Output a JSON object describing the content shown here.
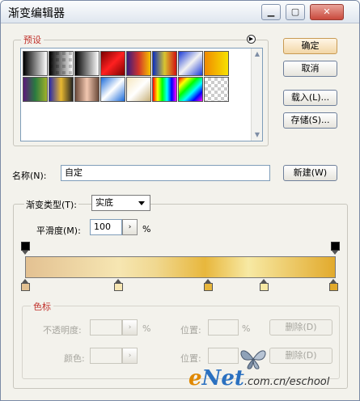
{
  "window": {
    "title": "渐变编辑器",
    "minimize_glyph": "▁",
    "maximize_glyph": "▢",
    "close_glyph": "✕"
  },
  "presets": {
    "label": "预设",
    "menu_icon": "circle-arrow-icon",
    "swatches": [
      "linear-gradient(to right,#000,#fff)",
      "checker-black",
      "linear-gradient(to right,#000,#fff)",
      "linear-gradient(135deg,#7a0000,#ff2020,#7a0000)",
      "linear-gradient(to right,#3a1c80,#d2342a,#f5c400)",
      "linear-gradient(to right,#0a2dbf,#d8c630,#d11111)",
      "linear-gradient(135deg,#1b3bd6,#f2f2f2,#1b3bd6)",
      "linear-gradient(to right,#f08a00,#f7e200)",
      "linear-gradient(to right,#5a1a7a,#2a7a40,#a0b22a)",
      "linear-gradient(to right,#2a2aa8,#e8b830,#222)",
      "linear-gradient(to right,#6b4a3a,#f2c7b0,#6b4a3a)",
      "linear-gradient(135deg,#1a6ad9,#ffffff,#1a6ad9)",
      "linear-gradient(135deg,#f6e7c0,#fff,#c9b27a)",
      "linear-gradient(to right,#ff0000,#ff0,#0f0,#0ff,#00f,#f0f)",
      "linear-gradient(135deg,#ff0000,#ff0,#0f0,#0ff,#00f,#f0f)",
      "checker-plain"
    ]
  },
  "buttons": {
    "ok": "确定",
    "cancel": "取消",
    "load": "载入(L)...",
    "save": "存储(S)...",
    "new": "新建(W)"
  },
  "name": {
    "label": "名称(N):",
    "value": "自定"
  },
  "gradient": {
    "type_label": "渐变类型(T):",
    "type_value": "实底",
    "smooth_label": "平滑度(M):",
    "smooth_value": "100",
    "smooth_unit": "%",
    "bottom_stop_colors": [
      "#e3c192",
      "#f6e6b2",
      "#e8b73c",
      "#f7e9a4",
      "#e2aa2c"
    ]
  },
  "color_stops": {
    "label": "色标",
    "opacity_label": "不透明度:",
    "opacity_unit": "%",
    "location_label": "位置:",
    "location_unit": "%",
    "delete_label": "删除(D)",
    "color_label": "颜色:"
  },
  "watermark": {
    "e": "e",
    "net": "Net",
    "rest": ".com.cn/eschool"
  }
}
